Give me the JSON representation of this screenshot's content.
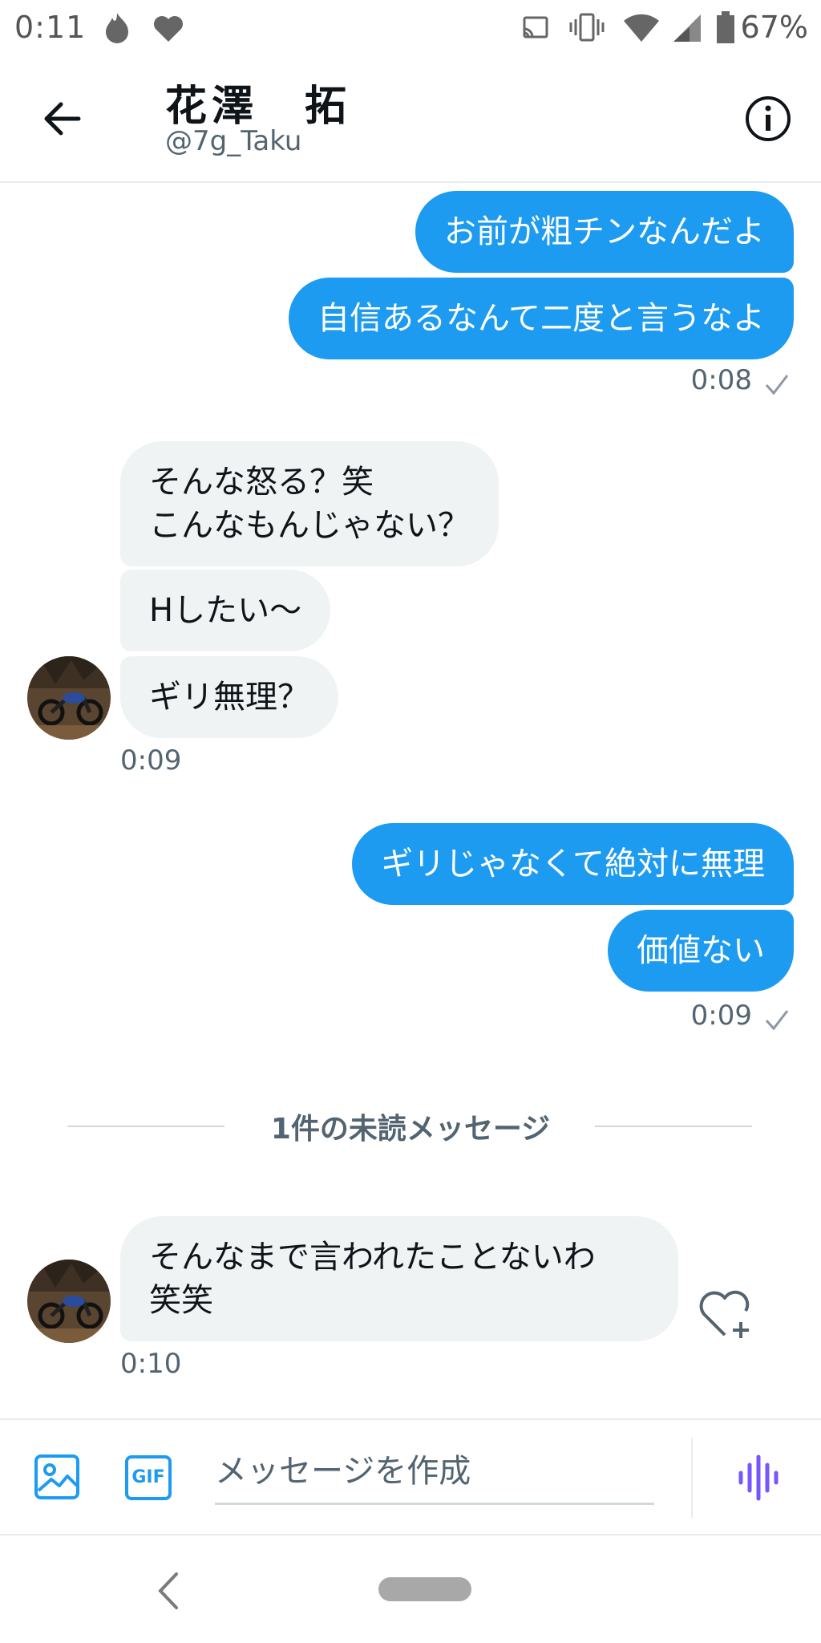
{
  "status_bar": {
    "time": "0:11",
    "battery": "67%"
  },
  "header": {
    "name": "花澤　拓",
    "handle": "@7g_Taku"
  },
  "messages": [
    {
      "from": "me",
      "text": "お前が粗チンなんだよ"
    },
    {
      "from": "me",
      "text": "自信あるなんて二度と言うなよ"
    },
    {
      "from": "me",
      "time": "0:08"
    },
    {
      "from": "them",
      "text": "そんな怒る？笑\nこんなもんじゃない？"
    },
    {
      "from": "them",
      "text": "Hしたい〜"
    },
    {
      "from": "them",
      "text": "ギリ無理？"
    },
    {
      "from": "them",
      "time": "0:09"
    },
    {
      "from": "me",
      "text": "ギリじゃなくて絶対に無理"
    },
    {
      "from": "me",
      "text": "価値ない"
    },
    {
      "from": "me",
      "time": "0:09"
    },
    {
      "from": "them",
      "text": "そんなまで言われたことないわ\n笑笑"
    },
    {
      "from": "them",
      "time": "0:10"
    }
  ],
  "unread_divider": "1件の未読メッセージ",
  "composer": {
    "gif_label": "GIF",
    "placeholder": "メッセージを作成"
  },
  "colors": {
    "sent_bubble": "#1d9bf0",
    "received_bubble": "#eff3f4",
    "voice_accent": "#7856ff"
  }
}
